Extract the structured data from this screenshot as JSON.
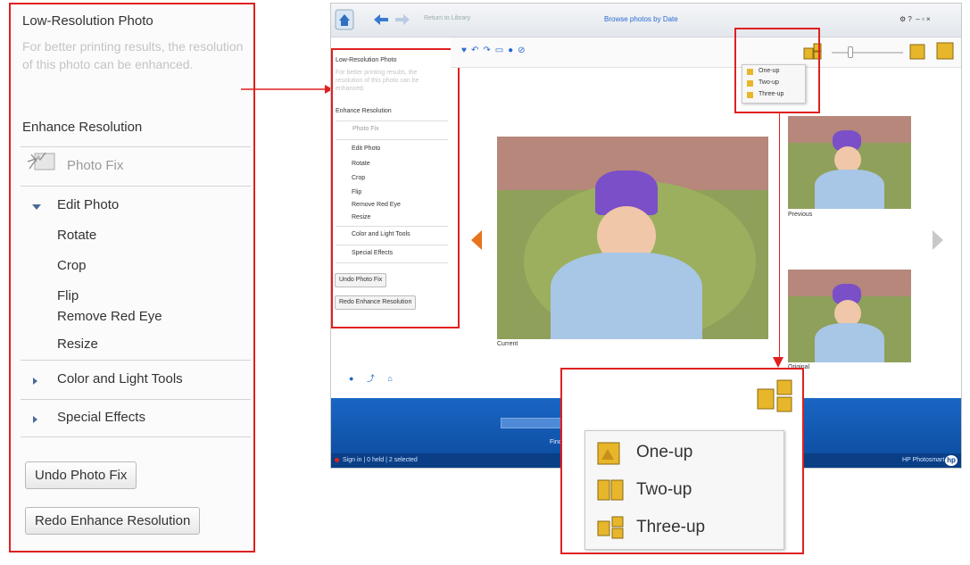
{
  "panel": {
    "title": "Low-Resolution Photo",
    "hint": "For better printing results, the resolution of this photo can be enhanced.",
    "enhance": "Enhance Resolution",
    "photo_fix": "Photo Fix",
    "edit_photo": "Edit Photo",
    "rotate": "Rotate",
    "crop": "Crop",
    "flip": "Flip",
    "remove_red_eye": "Remove Red Eye",
    "resize": "Resize",
    "color_light": "Color and Light Tools",
    "special_effects": "Special Effects",
    "undo": "Undo Photo Fix",
    "redo": "Redo Enhance Resolution"
  },
  "app": {
    "return_label": "Return to Library",
    "center_title": "Browse photos by Date",
    "window_controls": "⚙ ?  – ▫ ×",
    "current_label": "Current",
    "previous_label": "Previous",
    "original_label": "Original",
    "find_label": "Find",
    "status_left": "Sign in | 0 held | 2 selected",
    "status_right": "HP Photosmart"
  },
  "layout_menu": {
    "items": [
      "One-up",
      "Two-up",
      "Three-up"
    ]
  },
  "colors": {
    "highlight": "#e02020",
    "accent_blue": "#1a66c4",
    "arrow_orange": "#e8731c"
  }
}
